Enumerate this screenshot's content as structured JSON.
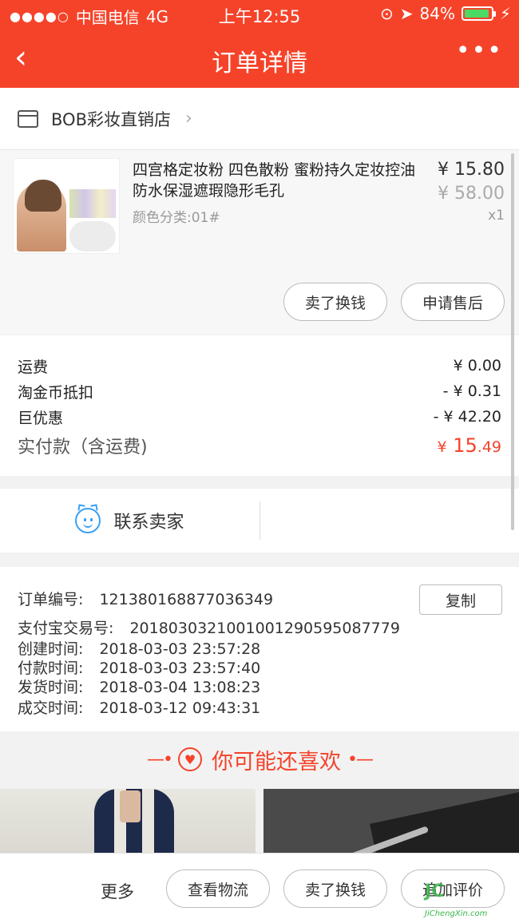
{
  "status_bar": {
    "signal_dots": "●●●●○",
    "carrier": "中国电信",
    "network": "4G",
    "time": "上午12:55",
    "battery_percent": "84%"
  },
  "nav": {
    "back_icon": "chevron-left-icon",
    "title": "订单详情",
    "more_icon": "ellipsis-icon",
    "back_glyph": "‹",
    "more_glyph": "•••"
  },
  "shop": {
    "icon": "store-icon",
    "name": "BOB彩妆直销店",
    "chevron": "›"
  },
  "product": {
    "title": "四宫格定妆粉 四色散粉 蜜粉持久定妆控油防水保湿遮瑕隐形毛孔",
    "sku": "颜色分类:01#",
    "price": "¥ 15.80",
    "original_price": "¥ 58.00",
    "quantity": "x1",
    "sell_button": "卖了换钱",
    "aftersale_button": "申请售后"
  },
  "summary": {
    "shipping_label": "运费",
    "shipping_value": "¥ 0.00",
    "coin_label": "淘金币抵扣",
    "coin_value": "- ¥ 0.31",
    "discount_label": "巨优惠",
    "discount_value": "- ¥ 42.20",
    "total_label": "实付款（含运费)",
    "total_currency": "¥",
    "total_integer": "15",
    "total_cents": ".49"
  },
  "contact": {
    "label": "联系卖家",
    "icon": "smiley-chat-icon"
  },
  "order_info": {
    "order_no_label": "订单编号:",
    "order_no": "121380168877036349",
    "copy_button": "复制",
    "alipay_label": "支付宝交易号:",
    "alipay_no": "2018030321001001290595087779",
    "created_label": "创建时间:",
    "created": "2018-03-03 23:57:28",
    "paid_label": "付款时间:",
    "paid": "2018-03-03 23:57:40",
    "shipped_label": "发货时间:",
    "shipped": "2018-03-04 13:08:23",
    "completed_label": "成交时间:",
    "completed": "2018-03-12 09:43:31"
  },
  "recommend": {
    "title": "你可能还喜欢",
    "left_deco": "—•",
    "right_deco": "•—",
    "heart_glyph": "♥"
  },
  "bottom_bar": {
    "more": "更多",
    "logistics_button": "查看物流",
    "sell_button": "卖了换钱",
    "review_button": "追加评价"
  },
  "watermark": {
    "mark": "JC",
    "site": "JiChengXin.com"
  },
  "colors": {
    "brand": "#f5432a",
    "accent_blue": "#3aa0f3",
    "battery_green": "#4cd964"
  }
}
